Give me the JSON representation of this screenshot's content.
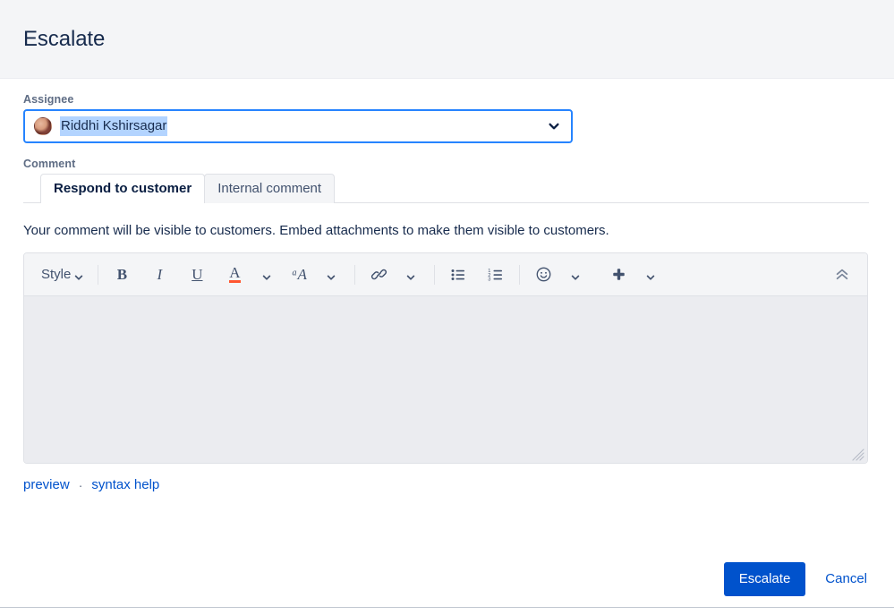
{
  "header": {
    "title": "Escalate"
  },
  "assignee": {
    "label": "Assignee",
    "selected_value": "Riddhi Kshirsagar",
    "avatar_name": "avatar",
    "chevron_icon": "chevron-down-icon"
  },
  "comment": {
    "label": "Comment",
    "tabs": [
      {
        "label": "Respond to customer",
        "active": true
      },
      {
        "label": "Internal comment",
        "active": false
      }
    ],
    "hint": "Your comment will be visible to customers. Embed attachments to make them visible to customers.",
    "editor_value": "",
    "links": [
      {
        "label": "preview"
      },
      {
        "label": "syntax help"
      }
    ],
    "link_separator": "·"
  },
  "toolbar": {
    "style_label": "Style",
    "bold_label": "B",
    "italic_label": "I",
    "underline_label": "U",
    "text_color_label": "A",
    "more_text_styles_label": "ᵃA",
    "items": [
      {
        "name": "style-dropdown",
        "label": "Style"
      },
      {
        "name": "bold-button",
        "label": "B"
      },
      {
        "name": "italic-button",
        "label": "I"
      },
      {
        "name": "underline-button",
        "label": "U"
      },
      {
        "name": "text-color-button",
        "label": "A"
      },
      {
        "name": "more-text-styles-button",
        "label": "ᵃA"
      },
      {
        "name": "link-button",
        "label": "link"
      },
      {
        "name": "bullet-list-button",
        "label": "bullet list"
      },
      {
        "name": "numbered-list-button",
        "label": "numbered list"
      },
      {
        "name": "emoji-button",
        "label": "emoji"
      },
      {
        "name": "insert-more-button",
        "label": "insert"
      },
      {
        "name": "collapse-toolbar-button",
        "label": "collapse"
      }
    ]
  },
  "footer": {
    "submit_label": "Escalate",
    "cancel_label": "Cancel"
  },
  "colors": {
    "primary": "#0052CC",
    "focus_ring": "#2684FF",
    "header_bg": "#F4F5F7",
    "editor_bg": "#EBECF0",
    "text": "#172B4D",
    "label": "#5E6C84",
    "text_color_underline": "#FF5630",
    "selection_highlight": "#B3D4FF"
  }
}
